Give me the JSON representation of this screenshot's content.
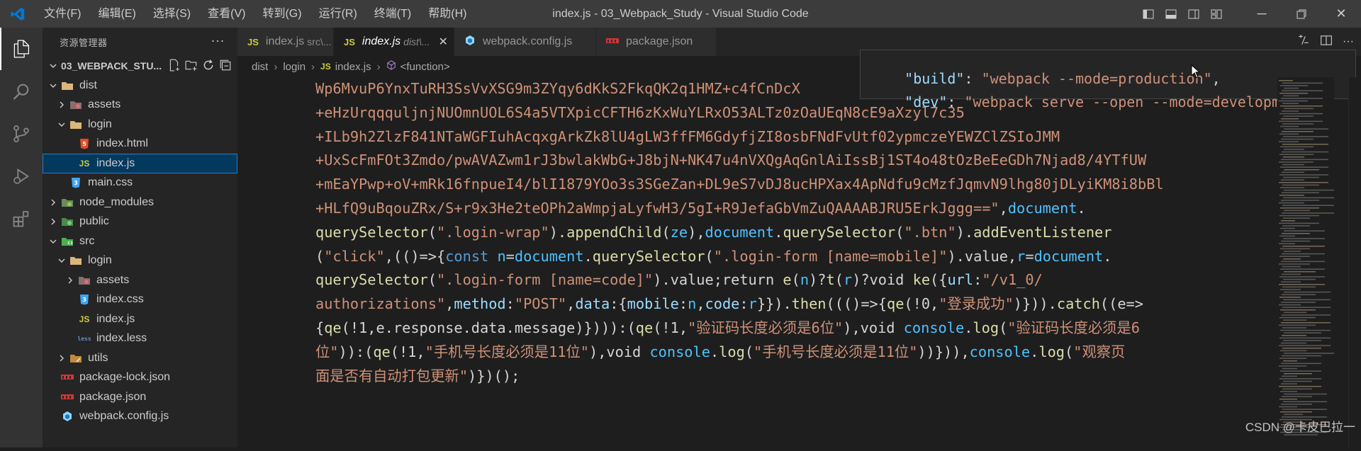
{
  "window": {
    "title": "index.js - 03_Webpack_Study - Visual Studio Code",
    "menu": [
      "文件(F)",
      "编辑(E)",
      "选择(S)",
      "查看(V)",
      "转到(G)",
      "运行(R)",
      "终端(T)",
      "帮助(H)"
    ]
  },
  "sidebar": {
    "title": "资源管理器",
    "more": "···",
    "project": "03_WEBPACK_STU...",
    "tree": [
      {
        "label": "dist",
        "type": "folder",
        "open": true
      },
      {
        "label": "assets",
        "type": "folder-assets",
        "open": false
      },
      {
        "label": "login",
        "type": "folder",
        "open": true
      },
      {
        "label": "index.html",
        "type": "html"
      },
      {
        "label": "index.js",
        "type": "js",
        "selected": true
      },
      {
        "label": "main.css",
        "type": "css"
      },
      {
        "label": "node_modules",
        "type": "folder-node",
        "open": false
      },
      {
        "label": "public",
        "type": "folder-public",
        "open": false
      },
      {
        "label": "src",
        "type": "folder-src",
        "open": true
      },
      {
        "label": "login",
        "type": "folder",
        "open": true
      },
      {
        "label": "assets",
        "type": "folder-assets",
        "open": false
      },
      {
        "label": "index.css",
        "type": "css"
      },
      {
        "label": "index.js",
        "type": "js"
      },
      {
        "label": "index.less",
        "type": "less"
      },
      {
        "label": "utils",
        "type": "folder-utils",
        "open": false
      },
      {
        "label": "package-lock.json",
        "type": "npm"
      },
      {
        "label": "package.json",
        "type": "npm"
      },
      {
        "label": "webpack.config.js",
        "type": "webpack"
      }
    ]
  },
  "tabs": [
    {
      "icon": "JS",
      "label": "index.js",
      "dim": "src\\...",
      "active": false
    },
    {
      "icon": "JS",
      "label": "index.js",
      "dim": "dist\\...",
      "active": true,
      "close": "✕"
    },
    {
      "icon": "webpack",
      "label": "webpack.config.js",
      "active": false
    },
    {
      "icon": "npm",
      "label": "package.json",
      "active": false
    }
  ],
  "breadcrumb": [
    "dist",
    "login",
    "index.js",
    "<function>"
  ],
  "breadcrumb_js_icon": "JS",
  "hover": {
    "line1_key": "\"build\"",
    "line1_colon": ": ",
    "line1_value": "\"webpack --mode=production\"",
    "line1_end": ",",
    "line2_key": "\"dev\"",
    "line2_colon": ": ",
    "line2_value": "\"webpack serve --open --mode=development\""
  },
  "code_lines": [
    [
      [
        "str",
        "Wp6MvuP6YnxTuRH3SsVvXSG9m3ZYqy6dKkS2FkqQK2q1HMZ+c4fCnDcX"
      ]
    ],
    [
      [
        "str",
        "+eHzUrqqquljnjNUOmnUOL6S4a5VTXpicCFTH6zKxWuYLRxO53ALTz0zOaUEqN8cE9aXzyl7c35"
      ]
    ],
    [
      [
        "str",
        "+ILb9h2ZlzF841NTaWGFIuhAcqxgArkZk8lU4gLW3ffFM6GdyfjZI8osbFNdFvUtf02ypmczeYEWZClZSIoJMM"
      ]
    ],
    [
      [
        "str",
        "+UxScFmFOt3Zmdo/pwAVAZwm1rJ3bwlakWbG+J8bjN+NK47u4nVXQgAqGnlAiIssBj1ST4o48tOzBeEeGDh7Njad8/4YTfUW"
      ]
    ],
    [
      [
        "str",
        "+mEaYPwp+oV+mRk16fnpueI4/blI1879YOo3s3SGeZan+DL9eS7vDJ8ucHPXax4ApNdfu9cMzfJqmvN9lhg80jDLyiKM8i8bBl"
      ]
    ],
    [
      [
        "str",
        "+HLfQ9uBqouZRx/S+r9x3He2teOPh2aWmpjaLyfwH3/5gI+R9JefaGbVmZuQAAAABJRU5ErkJggg==\""
      ],
      [
        "plain",
        ","
      ],
      [
        "var",
        "document"
      ],
      [
        "plain",
        "."
      ]
    ],
    [
      [
        "fn",
        "querySelector"
      ],
      [
        "plain",
        "("
      ],
      [
        "str",
        "\".login-wrap\""
      ],
      [
        "plain",
        ")."
      ],
      [
        "fn",
        "appendChild"
      ],
      [
        "plain",
        "("
      ],
      [
        "var",
        "ze"
      ],
      [
        "plain",
        "),"
      ],
      [
        "var",
        "document"
      ],
      [
        "plain",
        "."
      ],
      [
        "fn",
        "querySelector"
      ],
      [
        "plain",
        "("
      ],
      [
        "str",
        "\".btn\""
      ],
      [
        "plain",
        ")."
      ],
      [
        "fn",
        "addEventListener"
      ]
    ],
    [
      [
        "plain",
        "("
      ],
      [
        "str",
        "\"click\""
      ],
      [
        "plain",
        ",(()=>{"
      ],
      [
        "kw",
        "const "
      ],
      [
        "var",
        "n"
      ],
      [
        "plain",
        "="
      ],
      [
        "var",
        "document"
      ],
      [
        "plain",
        "."
      ],
      [
        "fn",
        "querySelector"
      ],
      [
        "plain",
        "("
      ],
      [
        "str",
        "\".login-form [name=mobile]\""
      ],
      [
        "plain",
        ").value,"
      ],
      [
        "var",
        "r"
      ],
      [
        "plain",
        "="
      ],
      [
        "var",
        "document"
      ],
      [
        "plain",
        "."
      ]
    ],
    [
      [
        "fn",
        "querySelector"
      ],
      [
        "plain",
        "("
      ],
      [
        "str",
        "\".login-form [name=code]\""
      ],
      [
        "plain",
        ").value;return "
      ],
      [
        "fn",
        "e"
      ],
      [
        "plain",
        "("
      ],
      [
        "var",
        "n"
      ],
      [
        "plain",
        ")?"
      ],
      [
        "fn",
        "t"
      ],
      [
        "plain",
        "("
      ],
      [
        "var",
        "r"
      ],
      [
        "plain",
        ")?void "
      ],
      [
        "fn",
        "ke"
      ],
      [
        "plain",
        "({"
      ],
      [
        "prop",
        "url"
      ],
      [
        "plain",
        ":"
      ],
      [
        "str",
        "\"/v1_0/"
      ]
    ],
    [
      [
        "str",
        "authorizations\""
      ],
      [
        "plain",
        ","
      ],
      [
        "prop",
        "method"
      ],
      [
        "plain",
        ":"
      ],
      [
        "str",
        "\"POST\""
      ],
      [
        "plain",
        ","
      ],
      [
        "prop",
        "data"
      ],
      [
        "plain",
        ":{"
      ],
      [
        "prop",
        "mobile"
      ],
      [
        "plain",
        ":"
      ],
      [
        "var",
        "n"
      ],
      [
        "plain",
        ","
      ],
      [
        "prop",
        "code"
      ],
      [
        "plain",
        ":"
      ],
      [
        "var",
        "r"
      ],
      [
        "plain",
        "}})."
      ],
      [
        "fn",
        "then"
      ],
      [
        "plain",
        "((()=>{"
      ],
      [
        "fn",
        "qe"
      ],
      [
        "plain",
        "(!0,"
      ],
      [
        "str",
        "\"登录成功\""
      ],
      [
        "plain",
        ")}))."
      ],
      [
        "fn",
        "catch"
      ],
      [
        "plain",
        "((e=>"
      ]
    ],
    [
      [
        "plain",
        "{"
      ],
      [
        "fn",
        "qe"
      ],
      [
        "plain",
        "(!1,e.response.data.message)}))):("
      ],
      [
        "fn",
        "qe"
      ],
      [
        "plain",
        "(!1,"
      ],
      [
        "str",
        "\"验证码长度必须是6位\""
      ],
      [
        "plain",
        "),void "
      ],
      [
        "var",
        "console"
      ],
      [
        "plain",
        "."
      ],
      [
        "fn",
        "log"
      ],
      [
        "plain",
        "("
      ],
      [
        "str",
        "\"验证码长度必须是6"
      ]
    ],
    [
      [
        "str",
        "位\""
      ],
      [
        "plain",
        ")):("
      ],
      [
        "fn",
        "qe"
      ],
      [
        "plain",
        "(!1,"
      ],
      [
        "str",
        "\"手机号长度必须是11位\""
      ],
      [
        "plain",
        "),void "
      ],
      [
        "var",
        "console"
      ],
      [
        "plain",
        "."
      ],
      [
        "fn",
        "log"
      ],
      [
        "plain",
        "("
      ],
      [
        "str",
        "\"手机号长度必须是11位\""
      ],
      [
        "plain",
        "))})),"
      ],
      [
        "var",
        "console"
      ],
      [
        "plain",
        "."
      ],
      [
        "fn",
        "log"
      ],
      [
        "plain",
        "("
      ],
      [
        "str",
        "\"观察页"
      ]
    ],
    [
      [
        "str",
        "面是否有自动打包更新\""
      ],
      [
        "plain",
        ")})();"
      ]
    ]
  ],
  "watermark": "CSDN @卡皮巴拉一"
}
